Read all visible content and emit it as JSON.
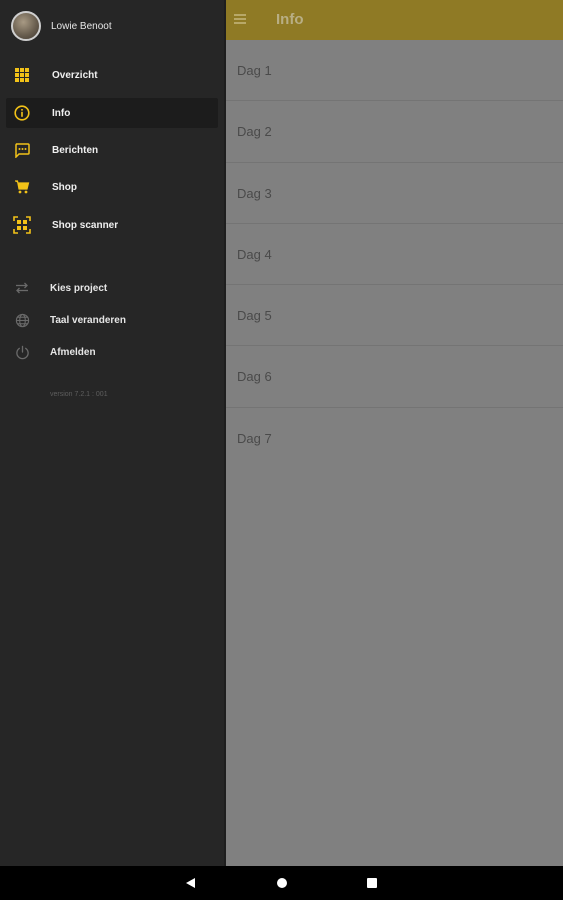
{
  "appbar": {
    "title": "Info",
    "menu_icon": "menu-icon",
    "color": "#8f7a25"
  },
  "days": [
    {
      "label": "Dag 1"
    },
    {
      "label": "Dag 2"
    },
    {
      "label": "Dag 3"
    },
    {
      "label": "Dag 4"
    },
    {
      "label": "Dag 5"
    },
    {
      "label": "Dag 6"
    },
    {
      "label": "Dag 7"
    }
  ],
  "drawer": {
    "user_name": "Lowie Benoot",
    "items": [
      {
        "label": "Overzicht",
        "icon": "grid-icon",
        "active": false
      },
      {
        "label": "Info",
        "icon": "info-icon",
        "active": true
      },
      {
        "label": "Berichten",
        "icon": "message-icon",
        "active": false
      },
      {
        "label": "Shop",
        "icon": "cart-icon",
        "active": false
      },
      {
        "label": "Shop scanner",
        "icon": "scanner-icon",
        "active": false
      }
    ],
    "secondary_items": [
      {
        "label": "Kies project",
        "icon": "swap-icon"
      },
      {
        "label": "Taal veranderen",
        "icon": "globe-icon"
      },
      {
        "label": "Afmelden",
        "icon": "power-icon"
      }
    ],
    "version": "version 7.2.1 : 001",
    "accent_color": "#f2c218"
  },
  "system_nav": {
    "back": "back-icon",
    "home": "home-icon",
    "recent": "recent-apps-icon"
  }
}
